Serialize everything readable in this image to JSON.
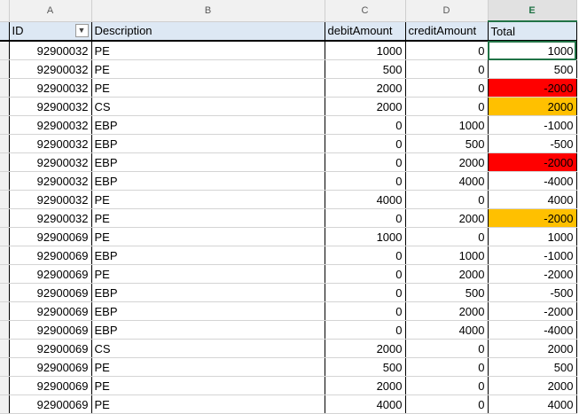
{
  "columns": [
    "A",
    "B",
    "C",
    "D",
    "E"
  ],
  "headers": {
    "id": "ID",
    "description": "Description",
    "debit": "debitAmount",
    "credit": "creditAmount",
    "total": "Total"
  },
  "icons": {
    "filter": "filter-icon"
  },
  "colors": {
    "highlight_red": "#ff0000",
    "highlight_amber": "#ffc000",
    "accent": "#217346"
  },
  "rows": [
    {
      "id": "92900032",
      "desc": "PE",
      "debit": "1000",
      "credit": "0",
      "total": "1000",
      "fill": ""
    },
    {
      "id": "92900032",
      "desc": "PE",
      "debit": "500",
      "credit": "0",
      "total": "500",
      "fill": ""
    },
    {
      "id": "92900032",
      "desc": "PE",
      "debit": "2000",
      "credit": "0",
      "total": "-2000",
      "fill": "red"
    },
    {
      "id": "92900032",
      "desc": "CS",
      "debit": "2000",
      "credit": "0",
      "total": "2000",
      "fill": "amber"
    },
    {
      "id": "92900032",
      "desc": "EBP",
      "debit": "0",
      "credit": "1000",
      "total": "-1000",
      "fill": ""
    },
    {
      "id": "92900032",
      "desc": "EBP",
      "debit": "0",
      "credit": "500",
      "total": "-500",
      "fill": ""
    },
    {
      "id": "92900032",
      "desc": "EBP",
      "debit": "0",
      "credit": "2000",
      "total": "-2000",
      "fill": "red"
    },
    {
      "id": "92900032",
      "desc": "EBP",
      "debit": "0",
      "credit": "4000",
      "total": "-4000",
      "fill": ""
    },
    {
      "id": "92900032",
      "desc": "PE",
      "debit": "4000",
      "credit": "0",
      "total": "4000",
      "fill": ""
    },
    {
      "id": "92900032",
      "desc": "PE",
      "debit": "0",
      "credit": "2000",
      "total": "-2000",
      "fill": "amber"
    },
    {
      "id": "92900069",
      "desc": "PE",
      "debit": "1000",
      "credit": "0",
      "total": "1000",
      "fill": ""
    },
    {
      "id": "92900069",
      "desc": "EBP",
      "debit": "0",
      "credit": "1000",
      "total": "-1000",
      "fill": ""
    },
    {
      "id": "92900069",
      "desc": "PE",
      "debit": "0",
      "credit": "2000",
      "total": "-2000",
      "fill": ""
    },
    {
      "id": "92900069",
      "desc": "EBP",
      "debit": "0",
      "credit": "500",
      "total": "-500",
      "fill": ""
    },
    {
      "id": "92900069",
      "desc": "EBP",
      "debit": "0",
      "credit": "2000",
      "total": "-2000",
      "fill": ""
    },
    {
      "id": "92900069",
      "desc": "EBP",
      "debit": "0",
      "credit": "4000",
      "total": "-4000",
      "fill": ""
    },
    {
      "id": "92900069",
      "desc": "CS",
      "debit": "2000",
      "credit": "0",
      "total": "2000",
      "fill": ""
    },
    {
      "id": "92900069",
      "desc": "PE",
      "debit": "500",
      "credit": "0",
      "total": "500",
      "fill": ""
    },
    {
      "id": "92900069",
      "desc": "PE",
      "debit": "2000",
      "credit": "0",
      "total": "2000",
      "fill": ""
    },
    {
      "id": "92900069",
      "desc": "PE",
      "debit": "4000",
      "credit": "0",
      "total": "4000",
      "fill": ""
    }
  ]
}
